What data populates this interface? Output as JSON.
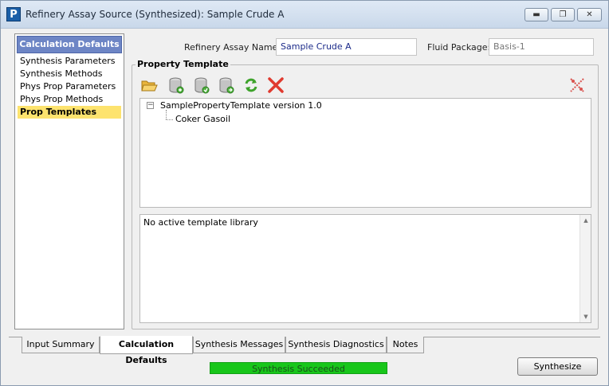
{
  "window": {
    "app_icon_letter": "P",
    "title": "Refinery Assay Source (Synthesized): Sample Crude A",
    "minimize_glyph": "▬",
    "maximize_glyph": "❐",
    "close_glyph": "✕"
  },
  "sidebar": {
    "header": "Calculation Defaults",
    "items": [
      {
        "label": "Synthesis Parameters"
      },
      {
        "label": "Synthesis Methods"
      },
      {
        "label": "Phys Prop Parameters"
      },
      {
        "label": "Phys Prop Methods"
      },
      {
        "label": "Prop Templates"
      }
    ],
    "active_index": 4
  },
  "header_fields": {
    "assay_name_label": "Refinery Assay Name:",
    "assay_name_value": "Sample Crude A",
    "fluid_package_label": "Fluid Package:",
    "fluid_package_value": "Basis-1"
  },
  "property_template": {
    "group_title": "Property Template",
    "toolbar_icons": [
      "open-folder-icon",
      "add-database-icon",
      "import-database-icon",
      "export-database-icon",
      "refresh-icon",
      "delete-icon",
      "remove-links-icon"
    ],
    "tree": {
      "expander": "−",
      "root_label": "SamplePropertyTemplate version 1.0",
      "child_label": "Coker Gasoil"
    },
    "message": "No active template library",
    "scroll_up": "▲",
    "scroll_down": "▼"
  },
  "tabs": [
    {
      "label": "Input Summary"
    },
    {
      "label": "Calculation Defaults"
    },
    {
      "label": "Synthesis Messages"
    },
    {
      "label": "Synthesis Diagnostics"
    },
    {
      "label": "Notes"
    }
  ],
  "status": {
    "text": "Synthesis Succeeded",
    "color": "#18c61a"
  },
  "actions": {
    "synthesize_label": "Synthesize"
  }
}
